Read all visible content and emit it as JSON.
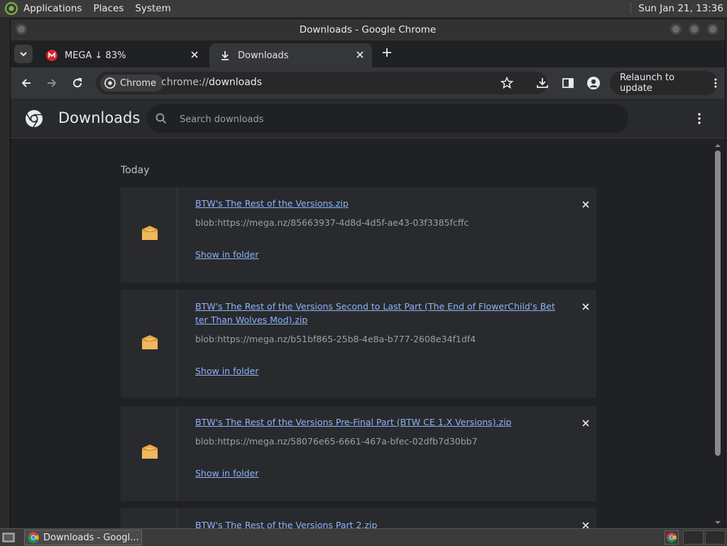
{
  "panel": {
    "menus": [
      "Applications",
      "Places",
      "System"
    ],
    "clock": "Sun Jan 21, 13:36"
  },
  "window": {
    "title": "Downloads - Google Chrome"
  },
  "tabs": [
    {
      "label": "MEGA ↓ 83%",
      "icon": "mega-icon",
      "active": false
    },
    {
      "label": "Downloads",
      "icon": "download-icon",
      "active": true
    }
  ],
  "toolbar": {
    "chip_label": "Chrome",
    "url_scheme": "chrome://",
    "url_host": "downloads",
    "relaunch_label": "Relaunch to update"
  },
  "downloads_page": {
    "title": "Downloads",
    "search_placeholder": "Search downloads",
    "section_label": "Today",
    "items": [
      {
        "name": "BTW's The Rest of the Versions.zip",
        "url": "blob:https://mega.nz/85663937-4d8d-4d5f-ae43-03f3385fcffc",
        "action": "Show in folder"
      },
      {
        "name": "BTW's The Rest of the Versions Second to Last Part (The End of FlowerChild's Better Than Wolves Mod).zip",
        "url": "blob:https://mega.nz/b51bf865-25b8-4e8a-b777-2608e34f1df4",
        "action": "Show in folder"
      },
      {
        "name": "BTW's The Rest of the Versions Pre-Final Part (BTW CE 1.X Versions).zip",
        "url": "blob:https://mega.nz/58076e65-6661-467a-bfec-02dfb7d30bb7",
        "action": "Show in folder"
      },
      {
        "name": "BTW's The Rest of the Versions Part 2.zip",
        "url": "",
        "action": ""
      }
    ]
  },
  "taskbar": {
    "task_label": "Downloads - Googl..."
  },
  "colors": {
    "link": "#8ab4f8",
    "background": "#202124",
    "card": "#292a2d"
  }
}
